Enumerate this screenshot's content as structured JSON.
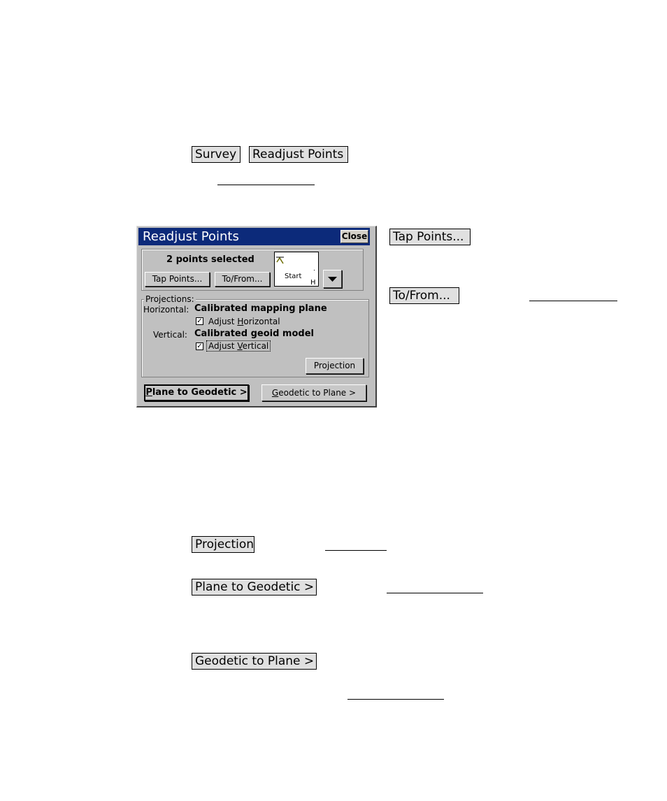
{
  "doc": {
    "survey_label": "Survey",
    "readjust_points_label": "Readjust Points",
    "tap_points_label": "Tap Points...",
    "to_from_label": "To/From...",
    "projection_label": "Projection",
    "plane_to_geodetic_label": "Plane to Geodetic >",
    "geodetic_to_plane_label": "Geodetic to Plane >"
  },
  "dialog": {
    "title": "Readjust Points",
    "close_label": "Close",
    "selection_text": "2 points selected",
    "tap_points_label": "Tap Points...",
    "to_from_label": "To/From...",
    "map": {
      "start_label": "Start",
      "h_label": "H"
    },
    "projections": {
      "group_label": "Projections:",
      "horizontal_label": "Horizontal:",
      "horizontal_value": "Calibrated mapping plane",
      "adjust_horizontal_pre": "Adjust ",
      "adjust_horizontal_key": "H",
      "adjust_horizontal_post": "orizontal",
      "adjust_horizontal_checked": true,
      "vertical_label": "Vertical:",
      "vertical_value": "Calibrated geoid model",
      "adjust_vertical_pre": "Adjust ",
      "adjust_vertical_key": "V",
      "adjust_vertical_post": "ertical",
      "adjust_vertical_checked": true,
      "projection_button": "Projection"
    },
    "plane_to_geodetic_key": "P",
    "plane_to_geodetic_rest": "lane to Geodetic >",
    "geodetic_to_plane_key": "G",
    "geodetic_to_plane_rest": "eodetic to Plane >"
  }
}
